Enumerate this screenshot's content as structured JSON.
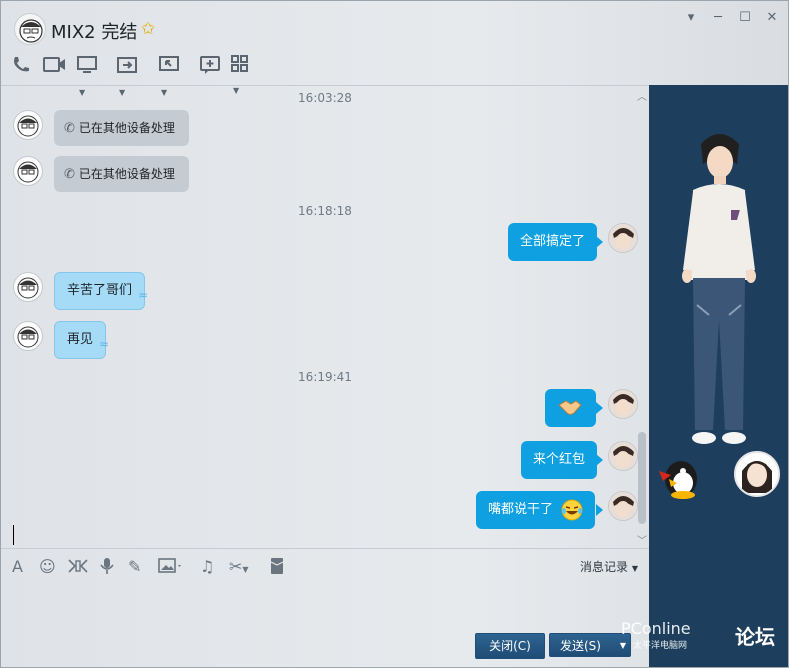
{
  "header": {
    "title": "MIX2  完结",
    "window_controls": [
      "▾",
      "─",
      "☐",
      "✕"
    ]
  },
  "toolbar": {
    "icons": [
      "phone-icon",
      "video-icon",
      "screen-share-icon",
      "file-transfer-icon",
      "remote-desktop-icon",
      "add-app-icon",
      "apps-grid-icon"
    ]
  },
  "chat": {
    "messages": [
      {
        "type": "timestamp",
        "text": "16:03:28"
      },
      {
        "type": "call",
        "side": "left",
        "text": "已在其他设备处理"
      },
      {
        "type": "call",
        "side": "left",
        "text": "已在其他设备处理"
      },
      {
        "type": "timestamp",
        "text": "16:18:18"
      },
      {
        "type": "text",
        "side": "right",
        "text": "全部搞定了"
      },
      {
        "type": "text",
        "side": "left",
        "text": "辛苦了哥们"
      },
      {
        "type": "text",
        "side": "left",
        "text": "再见"
      },
      {
        "type": "timestamp",
        "text": "16:19:41"
      },
      {
        "type": "emoji",
        "side": "right",
        "emoji": "handshake"
      },
      {
        "type": "text",
        "side": "right",
        "text": "来个红包"
      },
      {
        "type": "text",
        "side": "right",
        "text": "嘴都说干了",
        "emoji": "laughing-tears"
      }
    ]
  },
  "input_toolbar": {
    "history_label": "消息记录"
  },
  "actions": {
    "close_label": "关闭(C)",
    "send_label": "发送(S)"
  },
  "watermark": {
    "brand": "PConline",
    "sub": "太平洋电脑网",
    "forum": "论坛"
  },
  "colors": {
    "sent_bubble": "#0ea0e0",
    "received_bubble": "#a6dbf7",
    "side_panel": "#1d3f5d",
    "button": "#1f4d76"
  }
}
